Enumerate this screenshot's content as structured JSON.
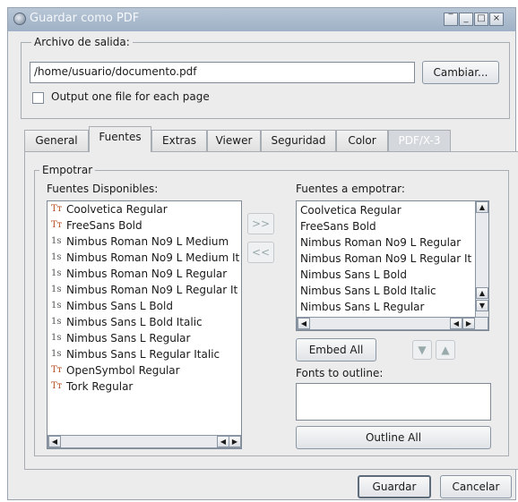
{
  "window": {
    "title": "Guardar como PDF"
  },
  "output_group": {
    "legend": "Archivo de salida:",
    "path_value": "/home/usuario/documento.pdf",
    "change_button": "Cambiar...",
    "one_file_checkbox": {
      "label": "Output one file for each page",
      "checked": false
    }
  },
  "tabs": [
    {
      "label": "General",
      "active": false,
      "enabled": true
    },
    {
      "label": "Fuentes",
      "active": true,
      "enabled": true
    },
    {
      "label": "Extras",
      "active": false,
      "enabled": true
    },
    {
      "label": "Viewer",
      "active": false,
      "enabled": true
    },
    {
      "label": "Seguridad",
      "active": false,
      "enabled": true
    },
    {
      "label": "Color",
      "active": false,
      "enabled": true
    },
    {
      "label": "PDF/X-3",
      "active": false,
      "enabled": false
    }
  ],
  "embed_group": {
    "legend": "Empotrar",
    "available_label": "Fuentes Disponibles:",
    "available_fonts": [
      {
        "name": "Coolvetica Regular",
        "icon": "truetype-font-icon"
      },
      {
        "name": "FreeSans Bold",
        "icon": "truetype-font-icon"
      },
      {
        "name": "Nimbus Roman No9 L Medium",
        "icon": "type1-font-icon"
      },
      {
        "name": "Nimbus Roman No9 L Medium It",
        "icon": "type1-font-icon"
      },
      {
        "name": "Nimbus Roman No9 L Regular",
        "icon": "type1-font-icon"
      },
      {
        "name": "Nimbus Roman No9 L Regular It",
        "icon": "type1-font-icon"
      },
      {
        "name": "Nimbus Sans L Bold",
        "icon": "type1-font-icon"
      },
      {
        "name": "Nimbus Sans L Bold Italic",
        "icon": "type1-font-icon"
      },
      {
        "name": "Nimbus Sans L Regular",
        "icon": "type1-font-icon"
      },
      {
        "name": "Nimbus Sans L Regular Italic",
        "icon": "type1-font-icon"
      },
      {
        "name": "OpenSymbol Regular",
        "icon": "truetype-font-icon"
      },
      {
        "name": "Tork Regular",
        "icon": "truetype-font-icon"
      }
    ],
    "add_button": ">>",
    "remove_button": "<<",
    "embed_label": "Fuentes a empotrar:",
    "embed_fonts": [
      "Coolvetica Regular",
      "FreeSans Bold",
      "Nimbus Roman No9 L Regular",
      "Nimbus Roman No9 L Regular It",
      "Nimbus Sans L Bold",
      "Nimbus Sans L Bold Italic",
      "Nimbus Sans L Regular"
    ],
    "embed_all_button": "Embed All",
    "outline_label": "Fonts to outline:",
    "outline_all_button": "Outline All"
  },
  "footer": {
    "save_button": "Guardar",
    "cancel_button": "Cancelar"
  }
}
